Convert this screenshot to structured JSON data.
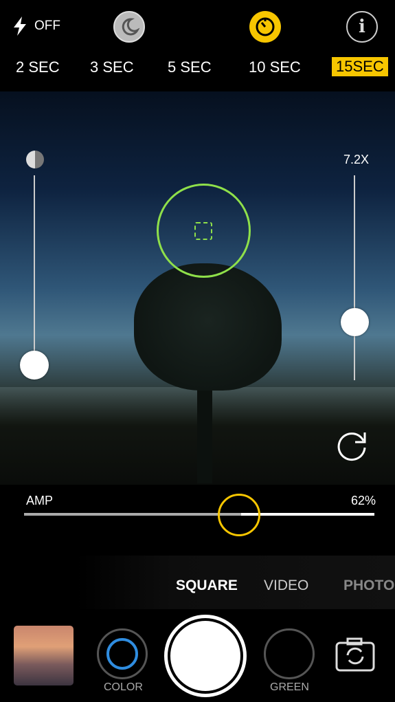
{
  "top_bar": {
    "flash_label": "OFF",
    "flash_icon": "lightning-icon",
    "night_icon": "moon-icon",
    "timer_icon": "timer-icon",
    "info_icon": "info-icon",
    "accent": "#f7c600"
  },
  "timer_options": [
    {
      "label": "2 SEC"
    },
    {
      "label": "3 SEC"
    },
    {
      "label": "5 SEC"
    },
    {
      "label": "10 SEC"
    },
    {
      "label": "15SEC",
      "selected": true
    }
  ],
  "viewfinder": {
    "zoom_label": "7.2X",
    "focus_color": "#8fe04a",
    "exposure_icon": "half-circle-icon",
    "rotate_icon": "rotate-icon",
    "exposure_level": 0.9,
    "zoom_level": 0.7
  },
  "amp": {
    "label": "AMP",
    "value_label": "62%",
    "value": 62
  },
  "modes": [
    {
      "label": "SQUARE",
      "selected": true
    },
    {
      "label": "VIDEO"
    },
    {
      "label": "PHOTO"
    }
  ],
  "bottom": {
    "filter_left_label": "COLOR",
    "filter_left_color": "#2f8de0",
    "filter_right_label": "GREEN",
    "switch_camera_icon": "switch-camera-icon"
  }
}
